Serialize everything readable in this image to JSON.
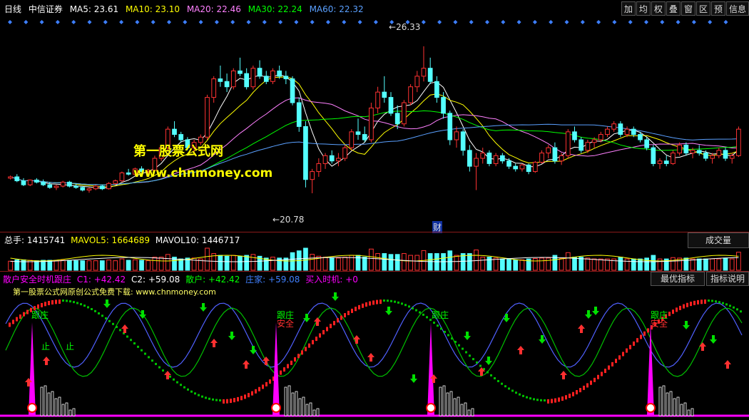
{
  "main_header": {
    "period": "日线",
    "stock_name": "中信证券",
    "ma5": "MA5: 23.61",
    "ma10": "MA10: 23.10",
    "ma20": "MA20: 22.46",
    "ma30": "MA30: 22.24",
    "ma60": "MA60: 22.32"
  },
  "toolbar": [
    "加",
    "均",
    "权",
    "叠",
    "窗",
    "区",
    "预",
    "信息"
  ],
  "colors": {
    "up": "#ff3232",
    "down": "#54ffff",
    "ma5": "#ffffff",
    "ma10": "#ffff00",
    "ma20": "#ff80ff",
    "ma30": "#00ff00",
    "ma60": "#5aa0ff",
    "magenta": "#ff00ff",
    "blue": "#4040ff",
    "green": "#00ff00"
  },
  "annotations": {
    "high_label": "26.33",
    "low_label": "20.78",
    "finance_mark": "财"
  },
  "watermark": {
    "title": "第一股票公式网",
    "url": "www.chnmoney.com"
  },
  "volume_header": {
    "total": "总手: 1415741",
    "mavol5": "MAVOL5: 1664689",
    "mavol10": "MAVOL10: 1446717",
    "button": "成交量"
  },
  "indicator_header": {
    "name": "散户安全时机跟庄",
    "c1": "C1: +42.42",
    "c2": "C2: +59.08",
    "retail": "散户: +42.42",
    "banker": "庄家: +59.08",
    "buy": "买入时机: +0",
    "btn_best": "最优指标",
    "btn_desc": "指标说明"
  },
  "indicator_promo": "第一股票公式网原创公式免费下载: www.chnmoney.com",
  "signal_labels": {
    "follow": "跟庄",
    "safe": "安全",
    "stop": "止"
  },
  "chart_data": {
    "type": "candlestick",
    "price_range": [
      20.0,
      27.0
    ],
    "high": 26.33,
    "low": 20.78,
    "candles": [
      [
        21.35,
        21.45,
        21.3,
        21.4
      ],
      [
        21.4,
        21.5,
        21.2,
        21.25
      ],
      [
        21.25,
        21.35,
        21.05,
        21.1
      ],
      [
        21.1,
        21.3,
        21.05,
        21.28
      ],
      [
        21.28,
        21.35,
        21.15,
        21.2
      ],
      [
        21.2,
        21.3,
        21.05,
        21.1
      ],
      [
        21.1,
        21.2,
        20.95,
        21.0
      ],
      [
        21.0,
        21.1,
        20.9,
        21.05
      ],
      [
        21.05,
        21.25,
        21.0,
        21.2
      ],
      [
        21.2,
        21.25,
        21.0,
        21.05
      ],
      [
        21.05,
        21.15,
        20.95,
        21.0
      ],
      [
        21.0,
        21.05,
        20.85,
        20.9
      ],
      [
        20.9,
        21.0,
        20.8,
        20.95
      ],
      [
        20.95,
        21.1,
        20.9,
        21.05
      ],
      [
        21.05,
        21.1,
        20.9,
        20.95
      ],
      [
        20.95,
        21.2,
        20.92,
        21.15
      ],
      [
        21.15,
        21.3,
        21.1,
        21.25
      ],
      [
        21.25,
        21.6,
        21.2,
        21.55
      ],
      [
        21.55,
        21.7,
        21.45,
        21.5
      ],
      [
        21.5,
        21.75,
        21.45,
        21.7
      ],
      [
        21.7,
        21.8,
        21.55,
        21.6
      ],
      [
        21.6,
        21.7,
        21.5,
        21.65
      ],
      [
        21.65,
        22.2,
        21.6,
        22.1
      ],
      [
        22.1,
        22.6,
        22.0,
        22.5
      ],
      [
        22.5,
        23.3,
        22.4,
        23.2
      ],
      [
        23.2,
        23.5,
        22.9,
        23.0
      ],
      [
        23.0,
        23.1,
        22.7,
        22.8
      ],
      [
        22.8,
        22.9,
        22.4,
        22.5
      ],
      [
        22.5,
        22.8,
        22.3,
        22.7
      ],
      [
        22.7,
        23.0,
        22.6,
        22.9
      ],
      [
        22.9,
        24.5,
        22.8,
        24.4
      ],
      [
        24.4,
        25.2,
        24.2,
        25.1
      ],
      [
        25.1,
        25.6,
        24.8,
        25.0
      ],
      [
        25.0,
        25.3,
        24.6,
        24.8
      ],
      [
        24.8,
        25.5,
        24.7,
        25.4
      ],
      [
        25.4,
        25.9,
        25.2,
        25.3
      ],
      [
        25.3,
        25.5,
        24.7,
        24.8
      ],
      [
        24.8,
        25.6,
        24.7,
        25.5
      ],
      [
        25.5,
        25.8,
        25.1,
        25.2
      ],
      [
        25.2,
        25.4,
        24.9,
        25.0
      ],
      [
        25.0,
        25.5,
        24.9,
        25.4
      ],
      [
        25.4,
        25.6,
        25.1,
        25.2
      ],
      [
        25.2,
        25.4,
        24.9,
        25.1
      ],
      [
        25.1,
        25.2,
        24.1,
        24.2
      ],
      [
        24.2,
        24.4,
        23.1,
        23.3
      ],
      [
        23.3,
        23.5,
        21.0,
        21.3
      ],
      [
        21.3,
        21.7,
        20.78,
        21.6
      ],
      [
        21.6,
        22.1,
        21.4,
        21.9
      ],
      [
        21.9,
        22.3,
        21.7,
        22.2
      ],
      [
        22.2,
        22.4,
        21.9,
        22.0
      ],
      [
        22.0,
        22.3,
        21.8,
        22.1
      ],
      [
        22.1,
        22.6,
        22.0,
        22.5
      ],
      [
        22.5,
        23.2,
        22.4,
        23.1
      ],
      [
        23.1,
        23.6,
        22.8,
        23.0
      ],
      [
        23.0,
        23.3,
        22.7,
        22.8
      ],
      [
        22.8,
        24.2,
        22.7,
        24.0
      ],
      [
        24.0,
        24.8,
        23.8,
        24.6
      ],
      [
        24.6,
        25.2,
        24.2,
        24.4
      ],
      [
        24.4,
        24.6,
        23.7,
        23.8
      ],
      [
        23.8,
        24.1,
        23.2,
        23.4
      ],
      [
        23.4,
        24.3,
        23.3,
        24.2
      ],
      [
        24.2,
        24.9,
        24.1,
        24.8
      ],
      [
        24.8,
        25.4,
        24.6,
        25.2
      ],
      [
        25.2,
        26.33,
        25.0,
        25.5
      ],
      [
        25.5,
        25.9,
        24.9,
        25.0
      ],
      [
        25.0,
        25.2,
        24.2,
        24.4
      ],
      [
        24.4,
        24.6,
        23.6,
        23.8
      ],
      [
        23.8,
        23.9,
        22.6,
        22.8
      ],
      [
        22.8,
        23.3,
        22.5,
        23.1
      ],
      [
        23.1,
        23.2,
        22.2,
        22.4
      ],
      [
        22.4,
        22.6,
        21.6,
        21.8
      ],
      [
        21.8,
        22.3,
        20.9,
        22.1
      ],
      [
        22.1,
        22.5,
        21.9,
        22.3
      ],
      [
        22.3,
        22.4,
        21.8,
        21.9
      ],
      [
        21.9,
        22.3,
        21.8,
        22.2
      ],
      [
        22.2,
        22.3,
        21.9,
        22.0
      ],
      [
        22.0,
        22.1,
        21.7,
        21.8
      ],
      [
        21.8,
        21.9,
        21.6,
        21.7
      ],
      [
        21.7,
        21.9,
        21.6,
        21.85
      ],
      [
        21.85,
        21.9,
        21.5,
        21.6
      ],
      [
        21.6,
        22.0,
        21.55,
        21.95
      ],
      [
        21.95,
        22.4,
        21.9,
        22.3
      ],
      [
        22.3,
        22.6,
        22.1,
        22.5
      ],
      [
        22.5,
        22.7,
        21.9,
        22.0
      ],
      [
        22.0,
        22.3,
        21.85,
        22.2
      ],
      [
        22.2,
        23.2,
        22.1,
        23.1
      ],
      [
        23.1,
        23.3,
        22.7,
        22.8
      ],
      [
        22.8,
        22.9,
        22.3,
        22.4
      ],
      [
        22.4,
        22.8,
        22.3,
        22.7
      ],
      [
        22.7,
        22.9,
        22.5,
        22.8
      ],
      [
        22.8,
        23.1,
        22.7,
        23.0
      ],
      [
        23.0,
        23.3,
        22.9,
        23.2
      ],
      [
        23.2,
        23.5,
        23.1,
        23.4
      ],
      [
        23.4,
        23.5,
        22.9,
        23.0
      ],
      [
        23.0,
        23.3,
        22.9,
        23.2
      ],
      [
        23.2,
        23.3,
        22.9,
        23.0
      ],
      [
        23.0,
        23.1,
        22.7,
        22.8
      ],
      [
        22.8,
        22.9,
        22.4,
        22.5
      ],
      [
        22.5,
        22.6,
        21.8,
        21.9
      ],
      [
        21.9,
        22.1,
        21.7,
        22.0
      ],
      [
        22.0,
        22.2,
        21.8,
        21.9
      ],
      [
        21.9,
        22.4,
        21.85,
        22.3
      ],
      [
        22.3,
        22.7,
        22.2,
        22.6
      ],
      [
        22.6,
        22.7,
        22.2,
        22.3
      ],
      [
        22.3,
        22.5,
        22.1,
        22.4
      ],
      [
        22.4,
        22.6,
        22.2,
        22.3
      ],
      [
        22.3,
        22.4,
        22.0,
        22.1
      ],
      [
        22.1,
        22.3,
        21.9,
        22.2
      ],
      [
        22.2,
        22.5,
        22.1,
        22.4
      ],
      [
        22.4,
        22.5,
        22.0,
        22.1
      ],
      [
        22.1,
        22.3,
        21.9,
        22.2
      ],
      [
        22.2,
        23.3,
        22.15,
        23.2
      ]
    ]
  }
}
